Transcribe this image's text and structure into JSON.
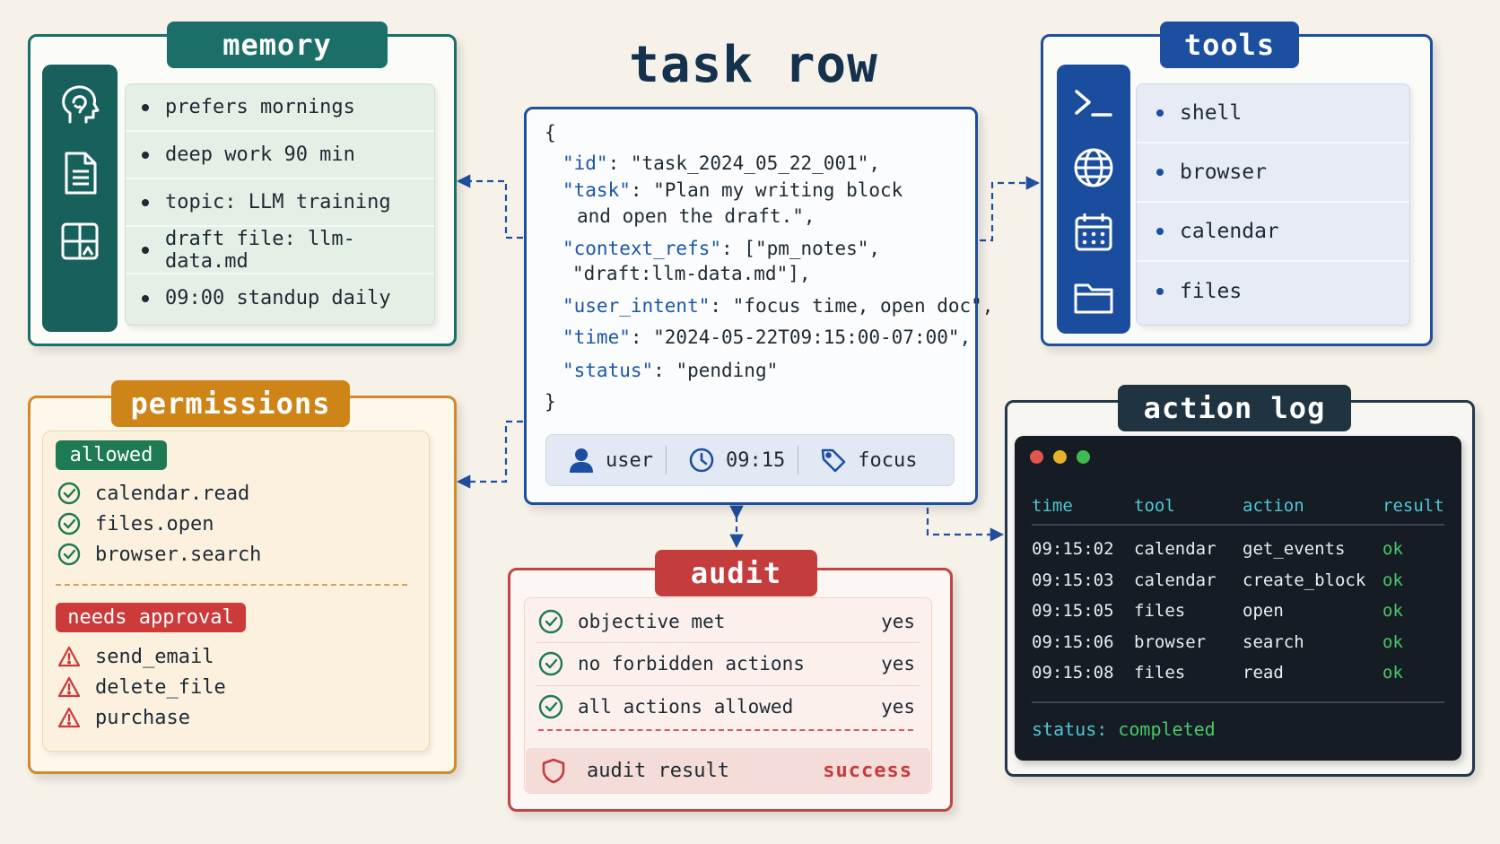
{
  "title": "task row",
  "memory": {
    "heading": "memory",
    "items": [
      "prefers mornings",
      "deep work 90 min",
      "topic: LLM training",
      "draft file: llm-data.md",
      "09:00 standup daily"
    ],
    "icons": [
      "head-icon",
      "document-icon",
      "layout-icon"
    ]
  },
  "tools": {
    "heading": "tools",
    "items": [
      "shell",
      "browser",
      "calendar",
      "files"
    ],
    "icons": [
      "terminal-icon",
      "globe-icon",
      "calendar-icon",
      "folder-icon"
    ]
  },
  "task": {
    "open_brace": "{",
    "close_brace": "}",
    "id_key": "\"id\"",
    "id_val": ": \"task_2024_05_22_001\",",
    "task_key": "\"task\"",
    "task_val_1": ": \"Plan my writing block",
    "task_val_2": "and open the draft.\",",
    "ctx_key": "\"context_refs\"",
    "ctx_val_1": ": [\"pm_notes\",",
    "ctx_val_2": "\"draft:llm-data.md\"],",
    "intent_key": "\"user_intent\"",
    "intent_val": ": \"focus time, open doc\",",
    "time_key": "\"time\"",
    "time_val": ": \"2024-05-22T09:15:00-07:00\",",
    "status_key": "\"status\"",
    "status_val": ": \"pending\"",
    "footer": {
      "user": "user",
      "time": "09:15",
      "tag": "focus"
    }
  },
  "permissions": {
    "heading": "permissions",
    "allowed_label": "allowed",
    "allowed": [
      "calendar.read",
      "files.open",
      "browser.search"
    ],
    "approval_label": "needs approval",
    "approval": [
      "send_email",
      "delete_file",
      "purchase"
    ]
  },
  "audit": {
    "heading": "audit",
    "rows": [
      {
        "label": "objective met",
        "value": "yes"
      },
      {
        "label": "no forbidden actions",
        "value": "yes"
      },
      {
        "label": "all actions allowed",
        "value": "yes"
      }
    ],
    "result_label": "audit result",
    "result_value": "success"
  },
  "action_log": {
    "heading": "action log",
    "columns": [
      "time",
      "tool",
      "action",
      "result"
    ],
    "rows": [
      [
        "09:15:02",
        "calendar",
        "get_events",
        "ok"
      ],
      [
        "09:15:03",
        "calendar",
        "create_block",
        "ok"
      ],
      [
        "09:15:05",
        "files",
        "open",
        "ok"
      ],
      [
        "09:15:06",
        "browser",
        "search",
        "ok"
      ],
      [
        "09:15:08",
        "files",
        "read",
        "ok"
      ]
    ],
    "status_label": "status:",
    "status_value": "completed"
  },
  "colors": {
    "memory": "#1b6f68",
    "tools": "#1c4f9f",
    "permissions": "#cf8418",
    "audit": "#c53c3c",
    "action_log": "#1f3340",
    "json_key": "#1c57a8",
    "ok": "#47c96b"
  }
}
